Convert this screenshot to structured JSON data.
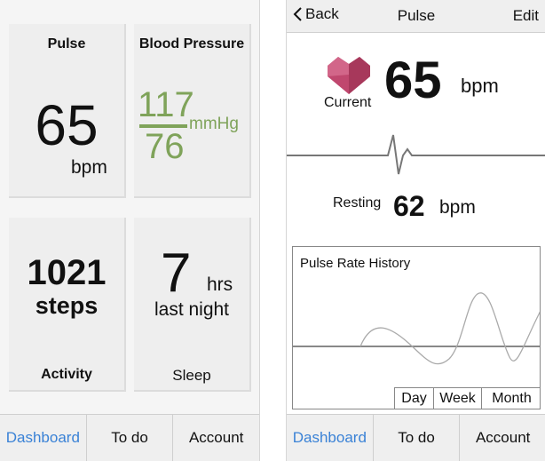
{
  "dashboard": {
    "pulse": {
      "title": "Pulse",
      "value": "65",
      "unit": "bpm"
    },
    "blood_pressure": {
      "title": "Blood Pressure",
      "systolic": "117",
      "diastolic": "76",
      "unit": "mmHg",
      "color": "#7fa35a"
    },
    "activity": {
      "value": "1021",
      "unit": "steps",
      "label": "Activity"
    },
    "sleep": {
      "value": "7",
      "unit": "hrs",
      "sub": "last night",
      "label": "Sleep"
    }
  },
  "tabbar": {
    "items": [
      {
        "label": "Dashboard",
        "active": true
      },
      {
        "label": "To do"
      },
      {
        "label": "Account"
      }
    ],
    "active_color": "#3a82d6"
  },
  "detail": {
    "nav": {
      "back_label": "Back",
      "title": "Pulse",
      "edit_label": "Edit"
    },
    "current": {
      "label": "Current",
      "value": "65",
      "unit": "bpm",
      "icon": "heart-icon",
      "icon_color": "#c0476e"
    },
    "resting": {
      "label": "Resting",
      "value": "62",
      "unit": "bpm"
    },
    "history": {
      "title": "Pulse Rate History",
      "ranges": [
        "Day",
        "Week",
        "Month"
      ]
    }
  }
}
